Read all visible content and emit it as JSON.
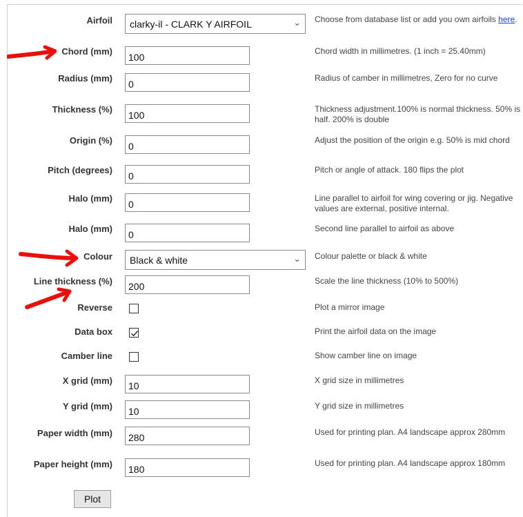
{
  "fields": {
    "airfoil": {
      "label": "Airfoil",
      "value": "clarky-il - CLARK Y AIRFOIL",
      "desc_prefix": "Choose from database list or add you own airfoils ",
      "desc_link": "here",
      "desc_suffix": "."
    },
    "chord": {
      "label": "Chord (mm)",
      "value": "100",
      "desc": "Chord width in millimetres. (1 inch = 25.40mm)"
    },
    "radius": {
      "label": "Radius (mm)",
      "value": "0",
      "desc": "Radius of camber in millimetres, Zero for no curve"
    },
    "thickness": {
      "label": "Thickness (%)",
      "value": "100",
      "desc": "Thickness adjustment.100% is normal thickness. 50% is half. 200% is double"
    },
    "origin": {
      "label": "Origin (%)",
      "value": "0",
      "desc": "Adjust the position of the origin e.g. 50% is mid chord"
    },
    "pitch": {
      "label": "Pitch (degrees)",
      "value": "0",
      "desc": "Pitch or angle of attack. 180 flips the plot"
    },
    "halo1": {
      "label": "Halo (mm)",
      "value": "0",
      "desc": "Line parallel to airfoil for wing covering or jig. Negative values are external, positive internal."
    },
    "halo2": {
      "label": "Halo (mm)",
      "value": "0",
      "desc": "Second line parallel to airfoil as above"
    },
    "colour": {
      "label": "Colour",
      "value": "Black & white",
      "desc": "Colour palette or black & white"
    },
    "line_thickness": {
      "label": "Line thickness (%)",
      "value": "200",
      "desc": "Scale the line thickness (10% to 500%)"
    },
    "reverse": {
      "label": "Reverse",
      "checked": false,
      "desc": "Plot a mirror image"
    },
    "data_box": {
      "label": "Data box",
      "checked": true,
      "desc": "Print the airfoil data on the image"
    },
    "camber_line": {
      "label": "Camber line",
      "checked": false,
      "desc": "Show camber line on image"
    },
    "x_grid": {
      "label": "X grid (mm)",
      "value": "10",
      "desc": "X grid size in millimetres"
    },
    "y_grid": {
      "label": "Y grid (mm)",
      "value": "10",
      "desc": "Y grid size in millimetres"
    },
    "paper_width": {
      "label": "Paper width (mm)",
      "value": "280",
      "desc": "Used for printing plan. A4 landscape approx 280mm"
    },
    "paper_height": {
      "label": "Paper height (mm)",
      "value": "180",
      "desc": "Used for printing plan. A4 landscape approx 180mm"
    }
  },
  "plot_button": "Plot",
  "annotation_color": "#e8100c"
}
